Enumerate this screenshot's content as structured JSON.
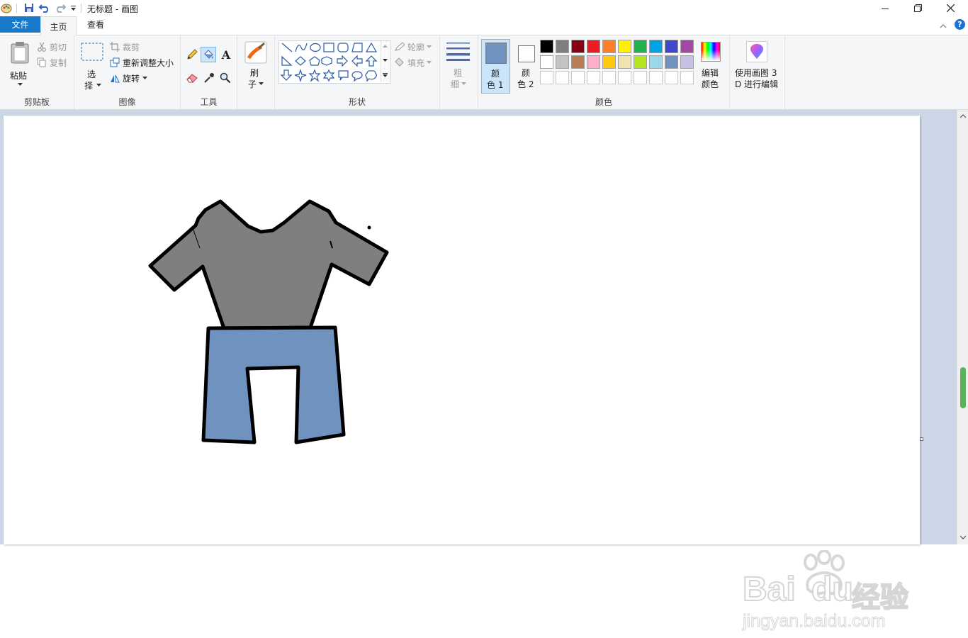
{
  "window": {
    "title": "无标题 - 画图"
  },
  "menu": {
    "file": "文件",
    "home": "主页",
    "view": "查看"
  },
  "clipboard": {
    "paste": "粘贴",
    "cut": "剪切",
    "copy": "复制",
    "label": "剪贴板"
  },
  "image": {
    "select_top": "选",
    "select_bottom": "择",
    "crop": "裁剪",
    "resize": "重新调整大小",
    "rotate": "旋转",
    "label": "图像"
  },
  "tools": {
    "label": "工具",
    "text_glyph": "A"
  },
  "brushes": {
    "top": "刷",
    "bottom": "子"
  },
  "shapes": {
    "outline": "轮廓",
    "fill": "填充",
    "label": "形状"
  },
  "size": {
    "top": "粗",
    "bottom": "细"
  },
  "colors": {
    "color1_top": "颜",
    "color1_bottom": "色 1",
    "color2_top": "颜",
    "color2_bottom": "色 2",
    "color1_value": "#7092be",
    "color2_value": "#ffffff",
    "edit_top": "编辑",
    "edit_bottom": "颜色",
    "label": "颜色",
    "palette_row1": [
      "#000000",
      "#7f7f7f",
      "#880015",
      "#ed1c24",
      "#ff7f27",
      "#fff200",
      "#22b14c",
      "#00a2e8",
      "#3f48cc",
      "#a349a4"
    ],
    "palette_row2": [
      "#ffffff",
      "#c3c3c3",
      "#b97a57",
      "#ffaec9",
      "#ffc90e",
      "#efe4b0",
      "#b5e61d",
      "#99d9ea",
      "#7092be",
      "#c8bfe7"
    ]
  },
  "paint3d": {
    "line1": "使用画图 3",
    "line2": "D 进行编辑"
  },
  "drawing": {
    "shirt_color": "#7f7f7f",
    "pants_color": "#7092be",
    "outline_color": "#000000"
  },
  "watermark": {
    "brand": "Bai",
    "brand2": "du",
    "cn": "经验",
    "url": "jingyan.baidu.com"
  }
}
